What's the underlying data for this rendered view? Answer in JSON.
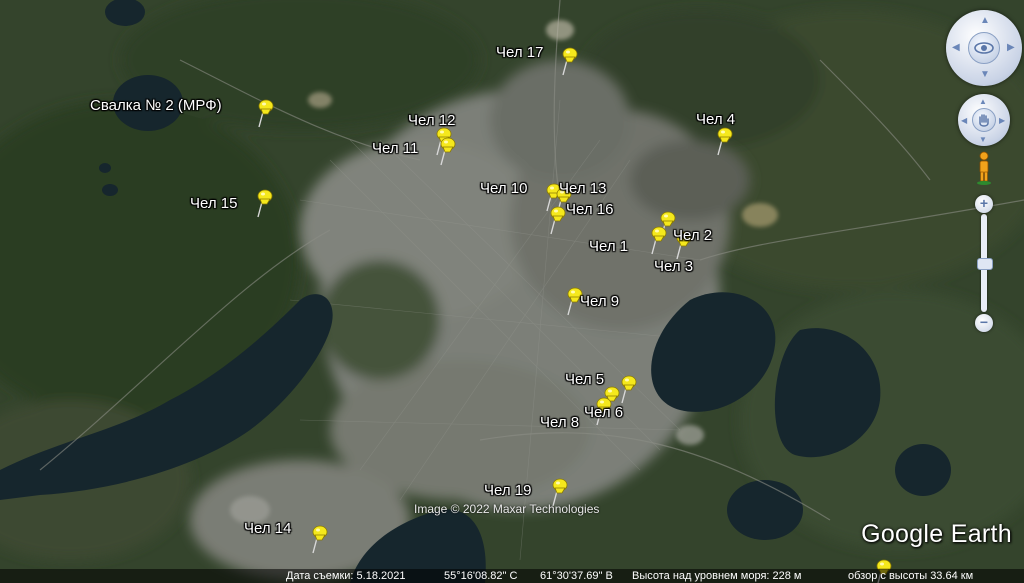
{
  "map": {
    "attribution": "Image © 2022 Maxar Technologies",
    "brand": "Google Earth",
    "pin_color": "#f5e81c",
    "label_color": "#ffffff",
    "markers": [
      {
        "label": "Свалка № 2 (МРФ)"
      },
      {
        "label": "Чел 17"
      },
      {
        "label": "Чел 12"
      },
      {
        "label": "Чел 11"
      },
      {
        "label": "Чел 4"
      },
      {
        "label": "Чел 10"
      },
      {
        "label": "Чел 13"
      },
      {
        "label": "Чел 16"
      },
      {
        "label": "Чел 15"
      },
      {
        "label": "Чел 2"
      },
      {
        "label": "Чел 1"
      },
      {
        "label": "Чел 3"
      },
      {
        "label": "Чел 9"
      },
      {
        "label": "Чел 5"
      },
      {
        "label": "Чел 6"
      },
      {
        "label": "Чел 8"
      },
      {
        "label": "Чел 19"
      },
      {
        "label": "Чел 14"
      }
    ]
  },
  "statusbar": {
    "date_label": "Дата съемки: 5.18.2021",
    "lat": "55°16'08.82\" С",
    "lon": "61°30'37.69\" В",
    "elevation": "Высота над уровнем моря:   228 м",
    "eye_alt": "обзор с высоты  33.64 км"
  },
  "controls": {
    "icons": [
      "eye-navigation-icon",
      "hand-pan-icon",
      "pegman-icon",
      "zoom-in-icon",
      "zoom-out-icon"
    ],
    "zoom_in": "+",
    "zoom_out": "−"
  }
}
